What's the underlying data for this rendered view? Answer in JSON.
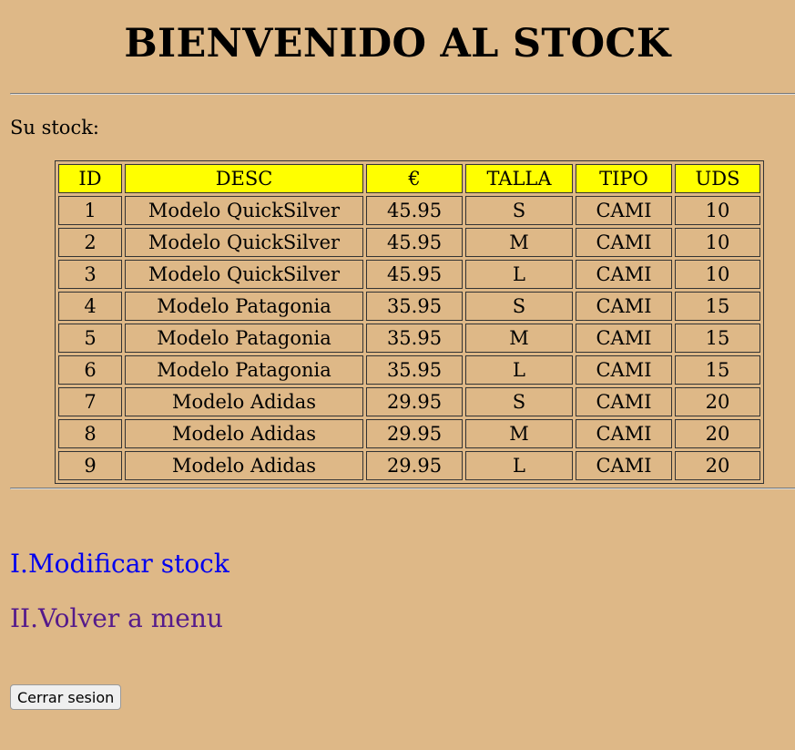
{
  "header": {
    "title": "BIENVENIDO AL STOCK"
  },
  "intro": "Su stock:",
  "stock_table": {
    "columns": {
      "id": "ID",
      "desc": "DESC",
      "price": "€",
      "talla": "TALLA",
      "tipo": "TIPO",
      "uds": "UDS"
    },
    "rows": [
      {
        "id": "1",
        "desc": "Modelo QuickSilver",
        "price": "45.95",
        "talla": "S",
        "tipo": "CAMI",
        "uds": "10"
      },
      {
        "id": "2",
        "desc": "Modelo QuickSilver",
        "price": "45.95",
        "talla": "M",
        "tipo": "CAMI",
        "uds": "10"
      },
      {
        "id": "3",
        "desc": "Modelo QuickSilver",
        "price": "45.95",
        "talla": "L",
        "tipo": "CAMI",
        "uds": "10"
      },
      {
        "id": "4",
        "desc": "Modelo Patagonia",
        "price": "35.95",
        "talla": "S",
        "tipo": "CAMI",
        "uds": "15"
      },
      {
        "id": "5",
        "desc": "Modelo Patagonia",
        "price": "35.95",
        "talla": "M",
        "tipo": "CAMI",
        "uds": "15"
      },
      {
        "id": "6",
        "desc": "Modelo Patagonia",
        "price": "35.95",
        "talla": "L",
        "tipo": "CAMI",
        "uds": "15"
      },
      {
        "id": "7",
        "desc": "Modelo Adidas",
        "price": "29.95",
        "talla": "S",
        "tipo": "CAMI",
        "uds": "20"
      },
      {
        "id": "8",
        "desc": "Modelo Adidas",
        "price": "29.95",
        "talla": "M",
        "tipo": "CAMI",
        "uds": "20"
      },
      {
        "id": "9",
        "desc": "Modelo Adidas",
        "price": "29.95",
        "talla": "L",
        "tipo": "CAMI",
        "uds": "20"
      }
    ]
  },
  "links": {
    "modificar": "I.Modificar stock",
    "volver": "II.Volver a menu"
  },
  "logout_label": "Cerrar sesion",
  "colors": {
    "background": "#deb887",
    "header_cell": "#ffff00",
    "link_unvisited": "#0000ee",
    "link_visited": "#551a8b"
  }
}
